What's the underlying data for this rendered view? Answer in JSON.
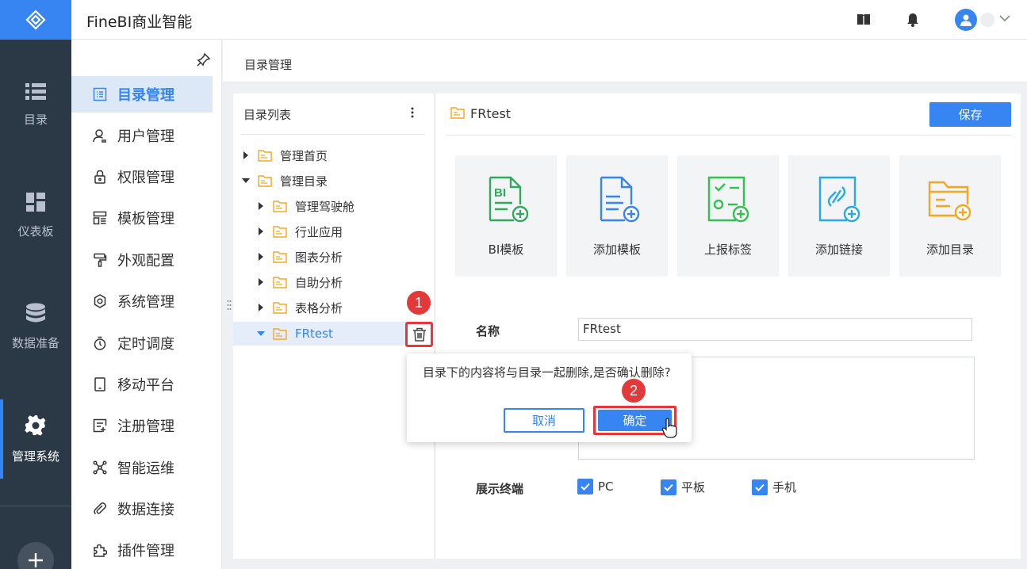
{
  "app": {
    "title": "FineBI商业智能"
  },
  "rail": {
    "items": [
      {
        "label": "目录",
        "icon": "list-icon"
      },
      {
        "label": "仪表板",
        "icon": "dashboard-icon"
      },
      {
        "label": "数据准备",
        "icon": "database-icon"
      },
      {
        "label": "管理系统",
        "icon": "gear-icon",
        "active": true
      }
    ]
  },
  "menu": {
    "items": [
      {
        "label": "目录管理",
        "icon": "catalog-icon",
        "active": true
      },
      {
        "label": "用户管理",
        "icon": "user-icon"
      },
      {
        "label": "权限管理",
        "icon": "lock-icon"
      },
      {
        "label": "模板管理",
        "icon": "template-icon"
      },
      {
        "label": "外观配置",
        "icon": "paint-roller-icon"
      },
      {
        "label": "系统管理",
        "icon": "settings-icon"
      },
      {
        "label": "定时调度",
        "icon": "timer-icon"
      },
      {
        "label": "移动平台",
        "icon": "tablet-icon"
      },
      {
        "label": "注册管理",
        "icon": "register-icon"
      },
      {
        "label": "智能运维",
        "icon": "network-icon"
      },
      {
        "label": "数据连接",
        "icon": "paperclip-icon"
      },
      {
        "label": "插件管理",
        "icon": "puzzle-icon"
      }
    ]
  },
  "breadcrumb": "目录管理",
  "tree": {
    "title": "目录列表",
    "items": [
      {
        "label": "管理首页",
        "level": 0,
        "expanded": false
      },
      {
        "label": "管理目录",
        "level": 0,
        "expanded": true
      },
      {
        "label": "管理驾驶舱",
        "level": 1,
        "expanded": false
      },
      {
        "label": "行业应用",
        "level": 1,
        "expanded": false
      },
      {
        "label": "图表分析",
        "level": 1,
        "expanded": false
      },
      {
        "label": "自助分析",
        "level": 1,
        "expanded": false
      },
      {
        "label": "表格分析",
        "level": 1,
        "expanded": false
      },
      {
        "label": "FRtest",
        "level": 1,
        "expanded": true,
        "selected": true
      }
    ]
  },
  "detail": {
    "title": "FRtest",
    "save_label": "保存",
    "tiles": [
      {
        "label": "BI模板",
        "icon": "bi-template-icon",
        "color": "#2eaa5c"
      },
      {
        "label": "添加模板",
        "icon": "add-template-icon",
        "color": "#3685f2"
      },
      {
        "label": "上报标签",
        "icon": "report-tag-icon",
        "color": "#2ec34f"
      },
      {
        "label": "添加链接",
        "icon": "add-link-icon",
        "color": "#27a9e8"
      },
      {
        "label": "添加目录",
        "icon": "add-folder-icon",
        "color": "#f5a623"
      }
    ],
    "name_label": "名称",
    "name_value": "FRtest",
    "terminal_label": "展示终端",
    "terminals": [
      {
        "label": "PC",
        "checked": true
      },
      {
        "label": "平板",
        "checked": true
      },
      {
        "label": "手机",
        "checked": true
      }
    ]
  },
  "confirm": {
    "message": "目录下的内容将与目录一起删除,是否确认删除?",
    "cancel_label": "取消",
    "ok_label": "确定"
  },
  "annotations": {
    "step1": "1",
    "step2": "2"
  },
  "colors": {
    "accent": "#3685f2",
    "rail": "#2b3846",
    "highlight": "#e23a3a",
    "folder": "#f5a623"
  }
}
